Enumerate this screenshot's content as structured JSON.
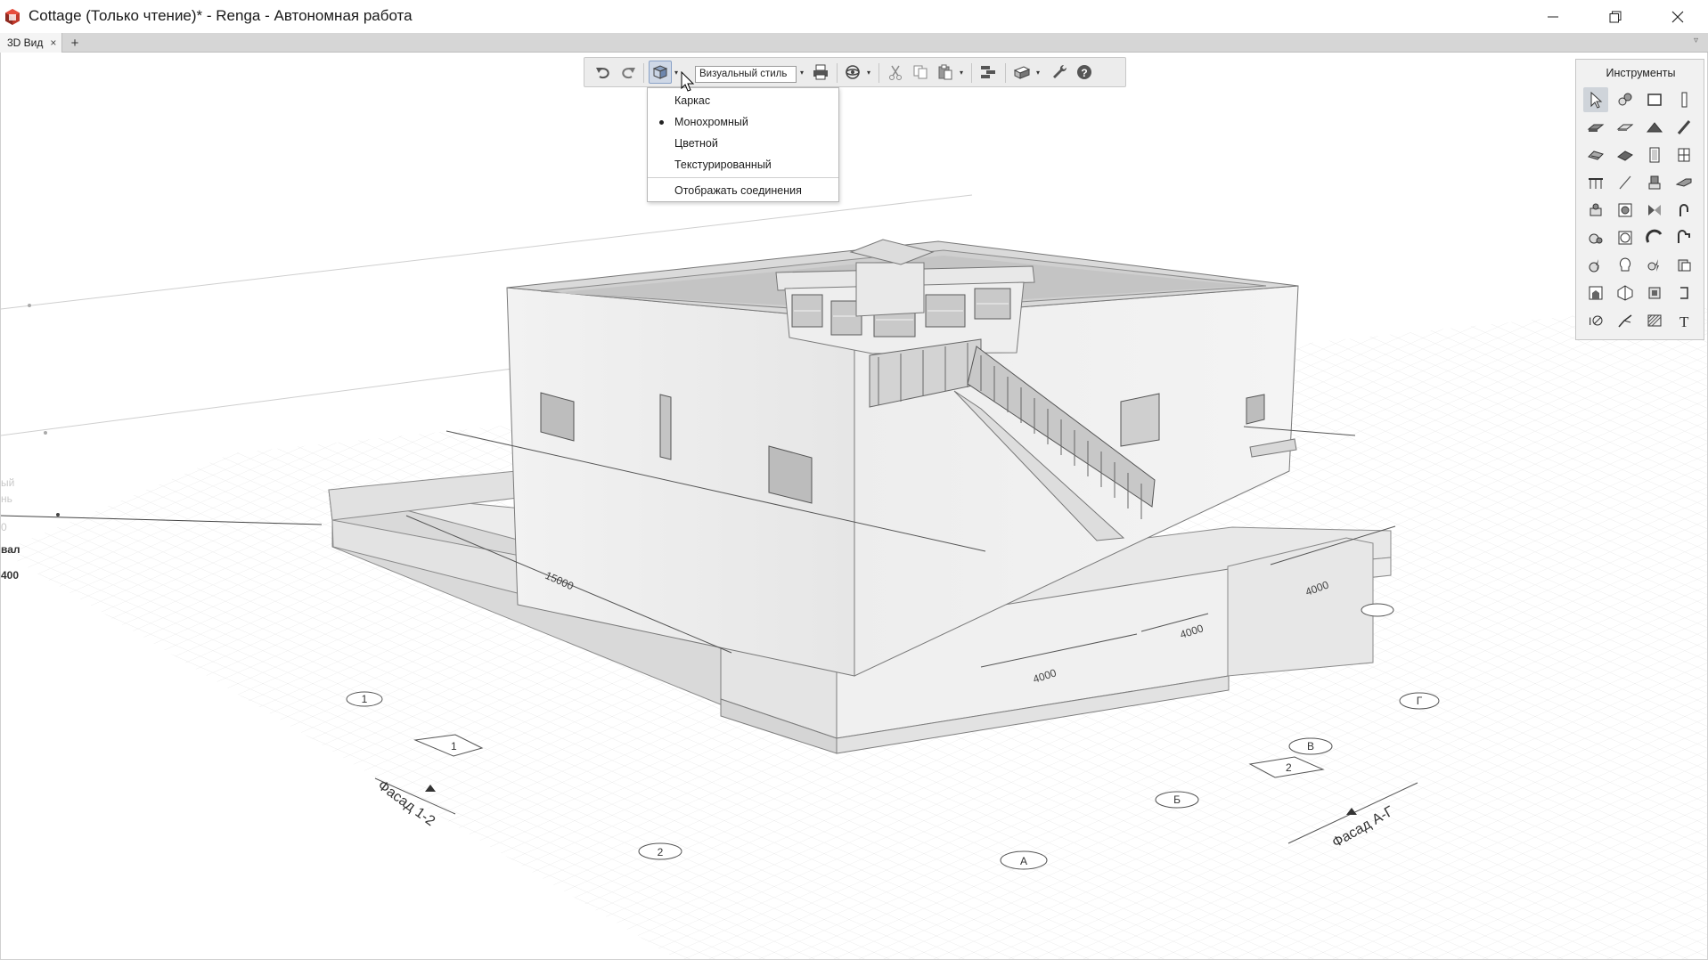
{
  "window": {
    "title": "Cottage (Только чтение)* - Renga - Автономная работа",
    "minimize_icon": "minimize-icon",
    "maximize_icon": "restore-icon",
    "close_icon": "close-icon"
  },
  "tabs": {
    "items": [
      {
        "label": "3D Вид",
        "close": "×"
      }
    ],
    "add_label": "+",
    "overflow_label": "▿"
  },
  "toolbar": {
    "buttons": [
      "undo-icon",
      "redo-icon",
      "visual-style-icon",
      "print-icon",
      "orbit-icon",
      "cut-icon",
      "copy-icon",
      "paste-icon",
      "levels-icon",
      "views-icon",
      "settings-icon",
      "help-icon"
    ],
    "visual_style_value": "Визуальный стиль",
    "arrow": "▾"
  },
  "visual_style_menu": {
    "items": [
      {
        "label": "Каркас",
        "selected": false
      },
      {
        "label": "Монохромный",
        "selected": true
      },
      {
        "label": "Цветной",
        "selected": false
      },
      {
        "label": "Текстурированный",
        "selected": false
      }
    ],
    "extra_item": "Отображать соединения"
  },
  "instruments": {
    "title": "Инструменты",
    "tools": [
      "select-icon",
      "group-icon",
      "rectangle-icon",
      "column-icon",
      "slab-icon",
      "floor-icon",
      "roof-icon",
      "beam-icon",
      "stair-icon",
      "ramp-icon",
      "door-icon",
      "window-icon",
      "railing-icon",
      "line-icon",
      "equipment-icon",
      "pipe-icon",
      "plumbing-icon",
      "furnace-icon",
      "valve-icon",
      "fitting-icon",
      "pump-icon",
      "boiler-icon",
      "duct-icon",
      "duct-fitting-icon",
      "electric-icon",
      "lamp-icon",
      "switch-icon",
      "panel-icon",
      "room-icon",
      "element-icon",
      "assembly-icon",
      "opening-icon",
      "dimension-icon",
      "leader-icon",
      "hatch-icon",
      "text-icon"
    ]
  },
  "scene": {
    "labels": {
      "left_level_1": "вал",
      "left_level_2": "400",
      "left_fade_1": "ый",
      "left_fade_2": "нь",
      "left_fade_3": "0",
      "facade_left": "Фасад 1-2",
      "facade_right": "Фасад А-Г",
      "dim_15000": "15000",
      "dim_4000_a": "4000",
      "dim_4000_b": "4000",
      "dim_4000_c": "4000",
      "axis_1": "1",
      "axis_2": "2",
      "axis_A": "А",
      "axis_B": "Б",
      "axis_V": "В",
      "axis_G": "Г",
      "tag_1": "1",
      "tag_2": "2"
    }
  }
}
